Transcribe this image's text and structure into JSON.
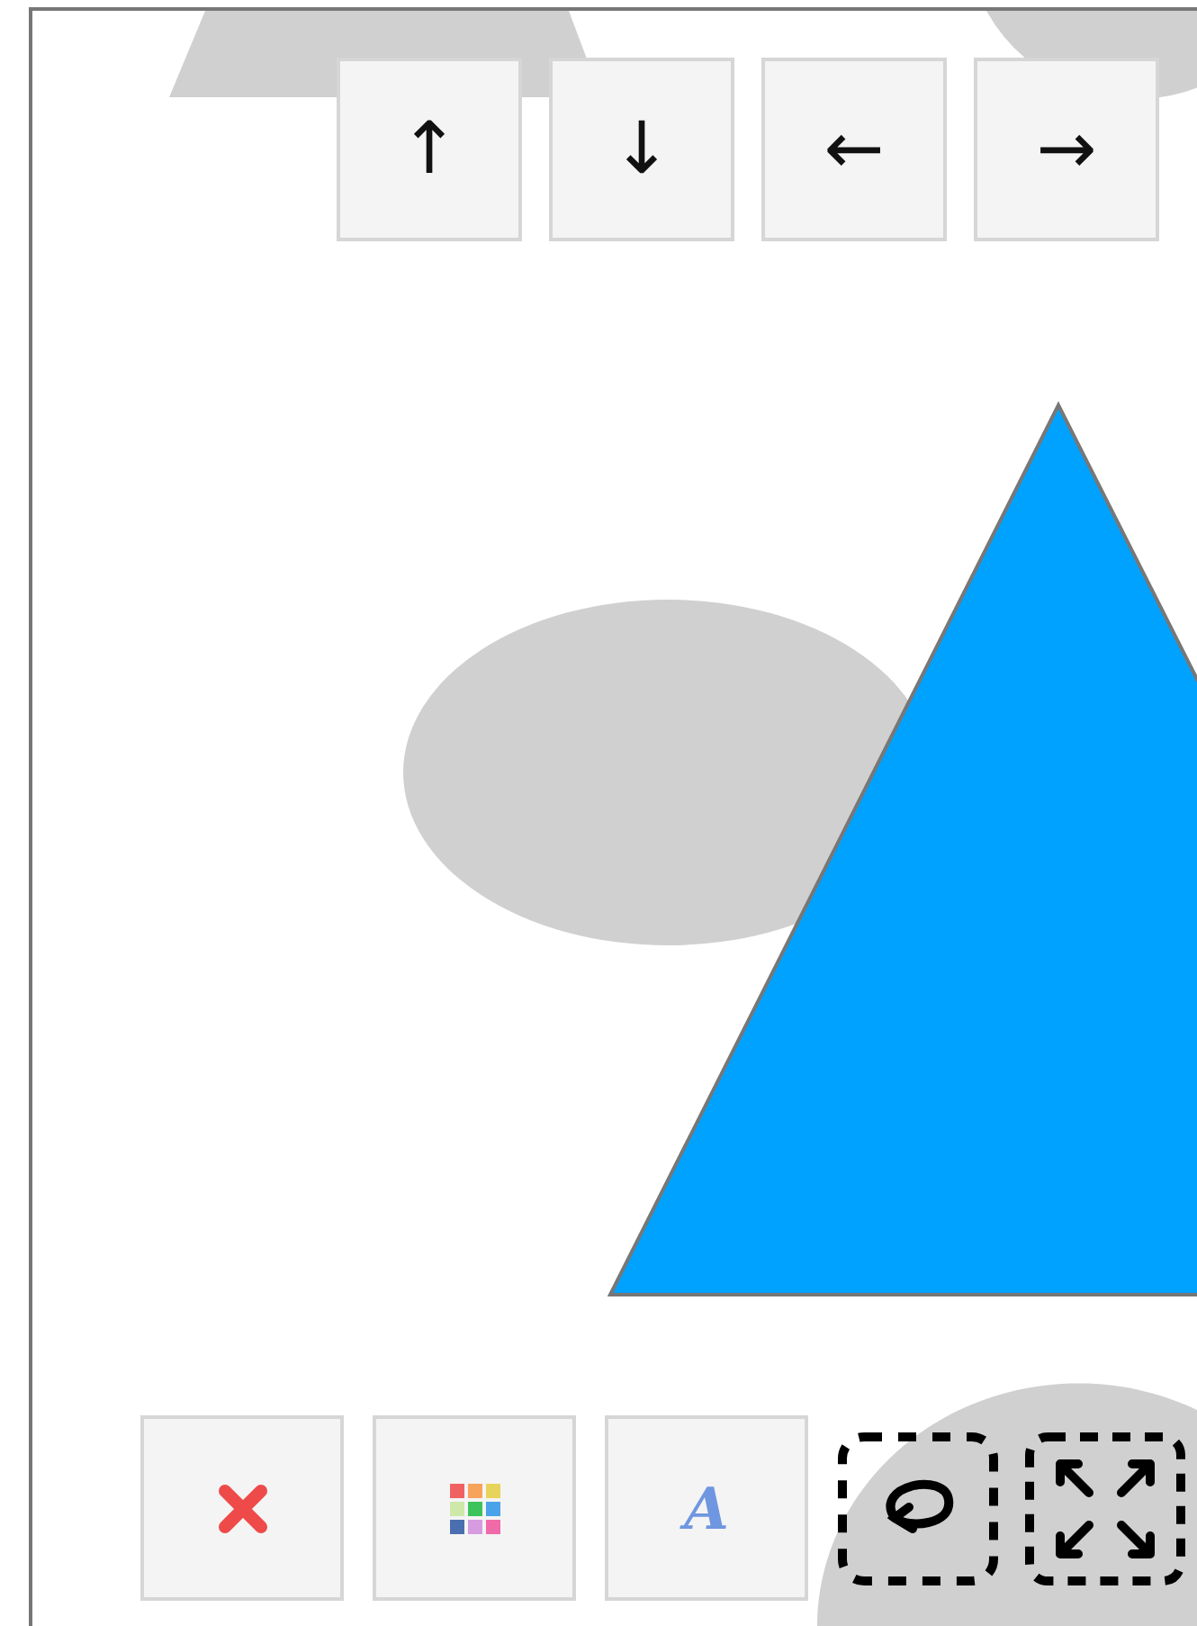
{
  "canvas": {
    "shapes": [
      {
        "kind": "trapezoid",
        "color": "#d0d0d0"
      },
      {
        "kind": "circle-top",
        "color": "#d0d0d0"
      },
      {
        "kind": "ellipse",
        "color": "#d0d0d0"
      },
      {
        "kind": "triangle",
        "color": "#00a2ff"
      },
      {
        "kind": "circle-bottom",
        "color": "#d0d0d0"
      }
    ]
  },
  "move_toolbar": {
    "buttons": [
      "↑",
      "↓",
      "←",
      "→"
    ]
  },
  "edit_toolbar": {
    "tools": [
      {
        "kind": "delete"
      },
      {
        "kind": "palette"
      },
      {
        "kind": "font",
        "label": "A"
      },
      {
        "kind": "lasso"
      },
      {
        "kind": "transform"
      }
    ]
  }
}
